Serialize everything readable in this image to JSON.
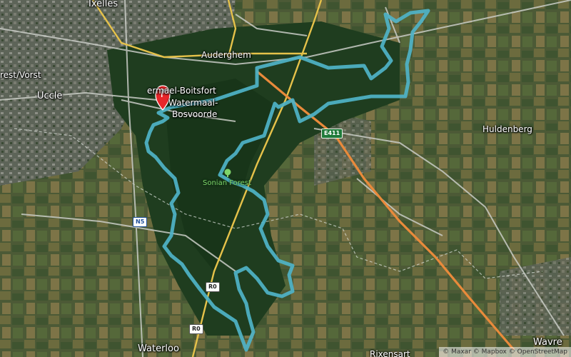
{
  "map": {
    "places": {
      "ixelles": "Ixelles",
      "auderghem": "Auderghem",
      "forest_vorst": "rest/Vorst",
      "uccle": "Uccle",
      "watermael_boitsfort_1": "ermael-Boitsfort",
      "watermael_boitsfort_2": "Watermaal-",
      "watermael_boitsfort_3": "Bosvoorde",
      "huldenberg": "Huldenberg",
      "waterloo": "Waterloo",
      "wavre": "Wavre",
      "rixensart": "Rixensart"
    },
    "poi": {
      "forest": "Sonian Forest",
      "forest_icon": "tree-icon"
    },
    "road_shields": {
      "e411": "E411",
      "n5": "N5",
      "r0_a": "R0",
      "r0_b": "R0"
    },
    "marker": {
      "icon": "flag-pin-icon",
      "color": "#e8262a"
    },
    "route": {
      "color": "#4fb3c8"
    },
    "attribution": "© Maxar © Mapbox © OpenStreetMap"
  }
}
